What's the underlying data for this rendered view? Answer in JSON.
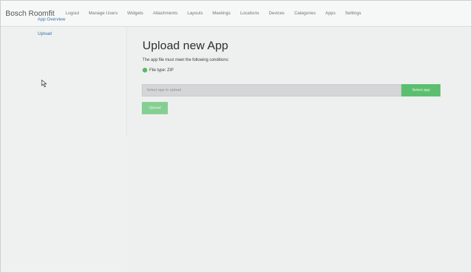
{
  "navbar": {
    "brand": "Bosch Roomfit",
    "links": [
      "Logout",
      "Manage Users",
      "Widgets",
      "Attachments",
      "Layouts",
      "Meetings",
      "Locations",
      "Devices",
      "Categories",
      "Apps",
      "Settings"
    ]
  },
  "sidebar": {
    "items": [
      {
        "label": "App Overview"
      },
      {
        "label": "Upload"
      }
    ]
  },
  "main": {
    "title": "Upload new App",
    "conditions_text": "The app file must meet the following conditions:",
    "conditions": [
      {
        "label": "File type: ZIP",
        "icon": "check-circle-icon",
        "color": "#5cb867"
      }
    ],
    "file_input": {
      "placeholder": "Select app to upload"
    },
    "select_button": "Select app",
    "upload_button": "Upload",
    "accent_color": "#5cbf6f"
  }
}
